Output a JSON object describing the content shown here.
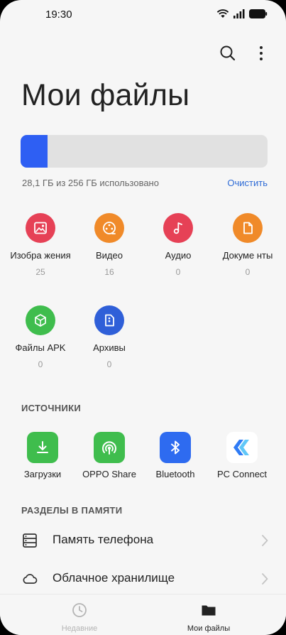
{
  "status": {
    "time": "19:30"
  },
  "page": {
    "title": "Мои файлы"
  },
  "storage": {
    "used_text": "28,1 ГБ из 256 ГБ использовано",
    "clear_label": "Очистить",
    "used_fraction": 0.11
  },
  "categories": [
    {
      "label": "Изобра жения",
      "count": "25",
      "color": "#e64156",
      "icon": "image-icon"
    },
    {
      "label": "Видео",
      "count": "16",
      "color": "#f08a29",
      "icon": "video-icon"
    },
    {
      "label": "Аудио",
      "count": "0",
      "color": "#e64156",
      "icon": "music-note-icon"
    },
    {
      "label": "Докуме нты",
      "count": "0",
      "color": "#f08a29",
      "icon": "document-icon"
    },
    {
      "label": "Файлы APK",
      "count": "0",
      "color": "#3fbd4d",
      "icon": "apk-cube-icon"
    },
    {
      "label": "Архивы",
      "count": "0",
      "color": "#2f5fd8",
      "icon": "archive-icon"
    }
  ],
  "sources": {
    "title": "ИСТОЧНИКИ",
    "items": [
      {
        "label": "Загрузки",
        "color": "#3fbd4d",
        "icon": "download-icon"
      },
      {
        "label": "OPPO Share",
        "color": "#3fbd4d",
        "icon": "oppo-share-icon"
      },
      {
        "label": "Bluetooth",
        "color": "#2e6bf0",
        "icon": "bluetooth-icon"
      },
      {
        "label": "PC Connect",
        "color": "#ffffff",
        "icon": "pc-connect-icon"
      }
    ]
  },
  "memory": {
    "title": "РАЗДЕЛЫ В ПАМЯТИ",
    "items": [
      {
        "label": "Память телефона",
        "icon": "phone-storage-icon"
      },
      {
        "label": "Облачное хранилище",
        "icon": "cloud-icon"
      }
    ]
  },
  "nav": {
    "recent_label": "Недавние",
    "files_label": "Мои файлы",
    "active_color": "#222222",
    "inactive_color": "#b5b5b5"
  }
}
